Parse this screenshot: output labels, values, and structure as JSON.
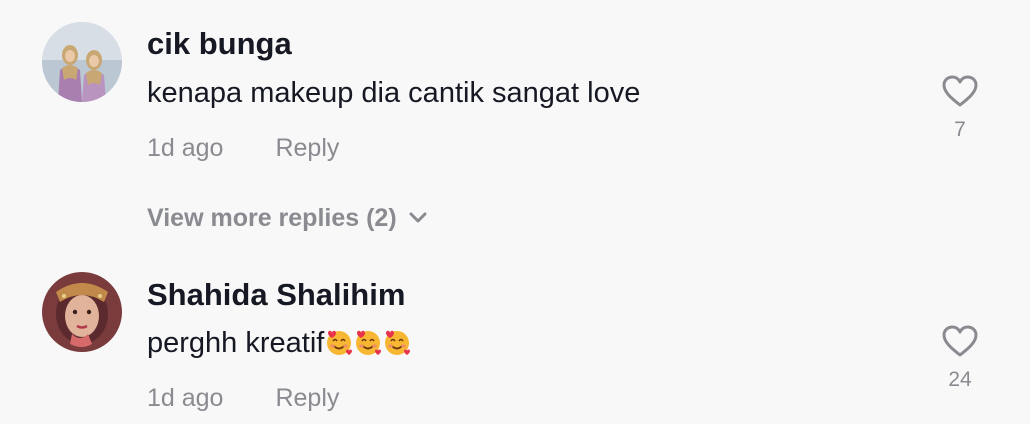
{
  "comments": [
    {
      "username": "cik bunga",
      "text": "kenapa makeup dia cantik sangat love",
      "time": "1d ago",
      "reply_label": "Reply",
      "likes": "7",
      "avatar_icon": "user-photo-two-women-hijab"
    },
    {
      "username": "Shahida Shalihim",
      "text": "perghh kreatif",
      "emojis": [
        "smiling-face-with-hearts-icon",
        "smiling-face-with-hearts-icon",
        "smiling-face-with-hearts-icon"
      ],
      "time": "1d ago",
      "reply_label": "Reply",
      "likes": "24",
      "avatar_icon": "user-photo-bride"
    }
  ],
  "view_more": {
    "label": "View more replies (2)",
    "icon": "chevron-down-icon"
  },
  "colors": {
    "background": "#f8f8f8",
    "primary_text": "#161823",
    "secondary_text": "#8a8b91",
    "heart_outline": "#8a8b91"
  }
}
